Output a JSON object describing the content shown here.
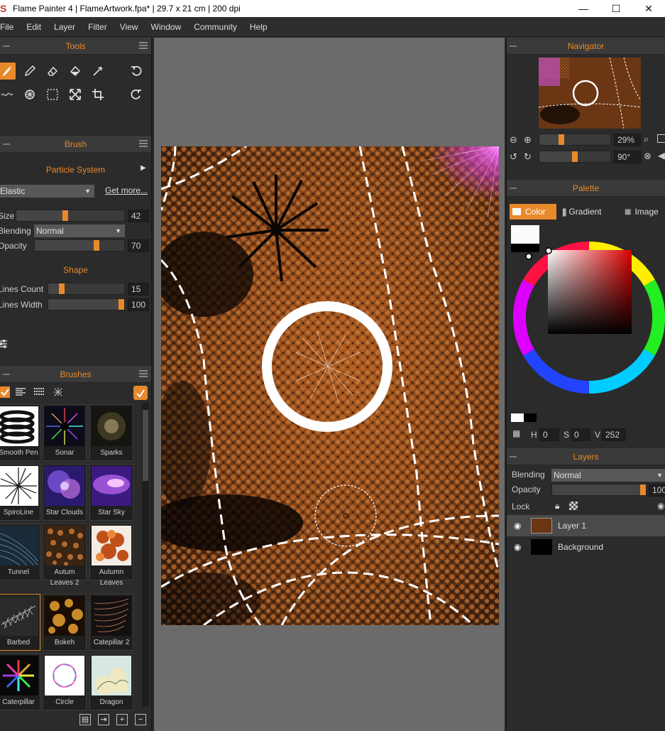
{
  "window": {
    "title": "Flame Painter 4 | FlameArtwork.fpa* | 29.7 x 21 cm | 200 dpi",
    "controls": [
      "—",
      "☐",
      "✕"
    ]
  },
  "menu": [
    "File",
    "Edit",
    "Layer",
    "Filter",
    "View",
    "Window",
    "Community",
    "Help"
  ],
  "tools": {
    "header": "Tools"
  },
  "brush": {
    "header": "Brush",
    "engine": "Particle System",
    "preset_dropdown": "Elastic",
    "get_more": "Get more...",
    "size_label": "Size",
    "size_value": "42",
    "size_level": 0.45,
    "blending_label": "Blending",
    "blending_value": "Normal",
    "opacity_label": "Opacity",
    "opacity_value": "70",
    "opacity_level": 0.7,
    "shape_title": "Shape",
    "lines_count_label": "Lines Count",
    "lines_count_value": "15",
    "lines_count_level": 0.15,
    "lines_width_label": "Lines Width",
    "lines_width_value": "100",
    "lines_width_level": 1.0
  },
  "brushes": {
    "header": "Brushes",
    "items": [
      {
        "label": "Smooth Pen"
      },
      {
        "label": "Sonar"
      },
      {
        "label": "Sparks"
      },
      {
        "label": "SpiroLine"
      },
      {
        "label": "Star Clouds"
      },
      {
        "label": "Star Sky"
      },
      {
        "label": "Tunnel"
      },
      {
        "label": "Autum Leaves 2"
      },
      {
        "label": "Autumn Leaves"
      },
      {
        "label": "Barbed"
      },
      {
        "label": "Bokeh"
      },
      {
        "label": "Catepillar 2"
      },
      {
        "label": "Caterpillar"
      },
      {
        "label": "Circle"
      },
      {
        "label": "Dragon"
      }
    ]
  },
  "navigator": {
    "header": "Navigator",
    "zoom": "29%",
    "zoom_level": 0.29,
    "rotation": "90°",
    "rotation_level": 0.5
  },
  "palette": {
    "header": "Palette",
    "tabs": [
      "Color",
      "Gradient",
      "Image"
    ],
    "active_tab": "Color",
    "h_label": "H",
    "h_value": "0",
    "s_label": "S",
    "s_value": "0",
    "v_label": "V",
    "v_value": "252",
    "primary_color": "#fcfcfc",
    "secondary_color": "#000000"
  },
  "layers": {
    "header": "Layers",
    "blending_label": "Blending",
    "blending_value": "Normal",
    "opacity_label": "Opacity",
    "opacity_value": "100",
    "opacity_level": 1.0,
    "lock_label": "Lock",
    "items": [
      {
        "name": "Layer 1",
        "active": true
      },
      {
        "name": "Background",
        "active": false
      }
    ]
  },
  "colors": {
    "accent": "#e8892b",
    "panel_bg": "#2b2b2b",
    "workspace_bg": "#6b6b6b"
  }
}
